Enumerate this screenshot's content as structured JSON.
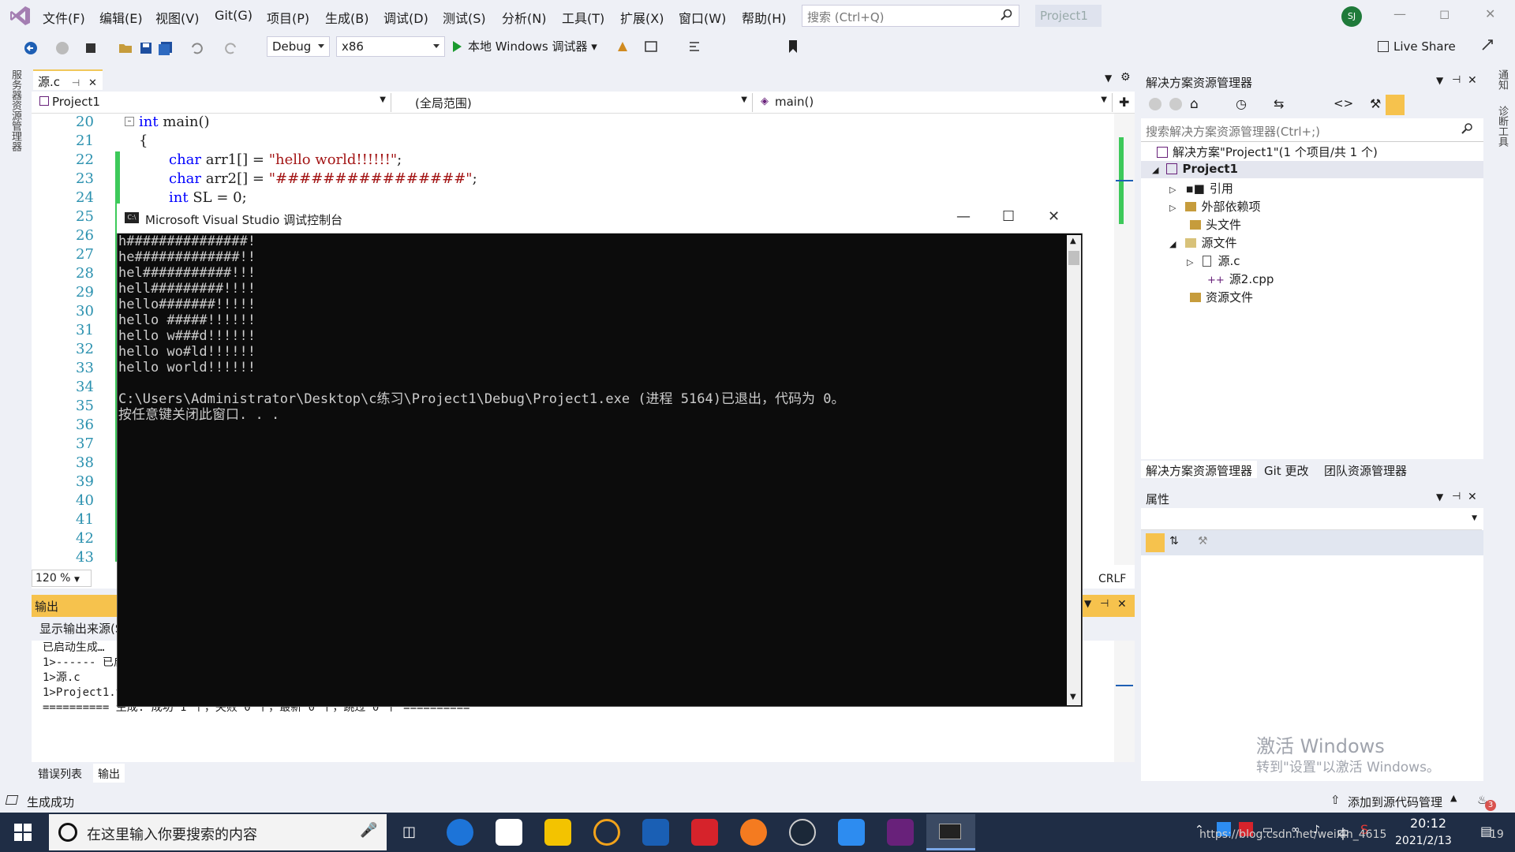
{
  "app": {
    "title": "Project1"
  },
  "menu": [
    "文件(F)",
    "编辑(E)",
    "视图(V)",
    "Git(G)",
    "项目(P)",
    "生成(B)",
    "调试(D)",
    "测试(S)",
    "分析(N)",
    "工具(T)",
    "扩展(X)",
    "窗口(W)",
    "帮助(H)"
  ],
  "search": {
    "placeholder": "搜索 (Ctrl+Q)"
  },
  "user": {
    "initials": "SJ"
  },
  "toolbar": {
    "config": "Debug",
    "platform": "x86",
    "run_label": "本地 Windows 调试器",
    "live_share": "Live Share"
  },
  "left_rail": {
    "label": "服务器资源管理器"
  },
  "right_rail": {
    "labels": [
      "通知",
      "诊断工具"
    ]
  },
  "editor": {
    "tab": "源.c",
    "nav": {
      "project": "Project1",
      "scope": "(全局范围)",
      "member": "main()"
    },
    "line_numbers": [
      "20",
      "21",
      "22",
      "23",
      "24",
      "25",
      "26",
      "27",
      "28",
      "29",
      "30",
      "31",
      "32",
      "33",
      "34",
      "35",
      "36",
      "37",
      "38",
      "39",
      "40",
      "41",
      "42",
      "43"
    ],
    "code": {
      "l20_kw": "int",
      "l20_rest": " main()",
      "l21": "{",
      "l22_kw": "char",
      "l22_mid": " arr1[] = ",
      "l22_str": "\"hello world!!!!!!\"",
      "l22_end": ";",
      "l23_kw": "char",
      "l23_mid": " arr2[] = ",
      "l23_str": "\"################\"",
      "l23_end": ";",
      "l24_kw": "int",
      "l24_rest": " SL = 0;"
    },
    "zoom": "120 %",
    "line_ending": "CRLF"
  },
  "console": {
    "title": "Microsoft Visual Studio 调试控制台",
    "lines": [
      "h###############!",
      "he#############!!",
      "hel###########!!!",
      "hell#########!!!!",
      "hello#######!!!!!",
      "hello #####!!!!!!",
      "hello w###d!!!!!!",
      "hello wo#ld!!!!!!",
      "hello world!!!!!!",
      "",
      "C:\\Users\\Administrator\\Desktop\\c练习\\Project1\\Debug\\Project1.exe (进程 5164)已退出，代码为 0。",
      "按任意键关闭此窗口. . ."
    ]
  },
  "output": {
    "title": "输出",
    "source_label": "显示输出来源(S",
    "lines": [
      "已启动生成…",
      "1>------ 已启",
      "1>源.c",
      "1>Project1.v",
      "========== 生成: 成功 1 个，失败 0 个，最新 0 个，跳过 0 个 =========="
    ],
    "tabs": [
      "错误列表",
      "输出"
    ]
  },
  "solution_explorer": {
    "title": "解决方案资源管理器",
    "search_placeholder": "搜索解决方案资源管理器(Ctrl+;)",
    "items": [
      {
        "label": "解决方案\"Project1\"(1 个项目/共 1 个)"
      },
      {
        "label": "Project1"
      },
      {
        "label": "引用"
      },
      {
        "label": "外部依赖项"
      },
      {
        "label": "头文件"
      },
      {
        "label": "源文件"
      },
      {
        "label": "源.c"
      },
      {
        "label": "源2.cpp"
      },
      {
        "label": "资源文件"
      }
    ],
    "tabs": [
      "解决方案资源管理器",
      "Git 更改",
      "团队资源管理器"
    ]
  },
  "properties": {
    "title": "属性"
  },
  "watermark": {
    "line1": "激活 Windows",
    "line2": "转到\"设置\"以激活 Windows。"
  },
  "status": {
    "left": "生成成功",
    "right": "添加到源代码管理",
    "notif_count": "3"
  },
  "taskbar": {
    "search_placeholder": "在这里输入你要搜索的内容",
    "tray_input": "中",
    "time": "20:12",
    "date": "2021/2/13",
    "url_overlay": "https://blog.csdn.net/weixin_4615",
    "url_suffix": "19"
  },
  "colors": {
    "accent": "#68217a",
    "status_bg": "#eef0f6",
    "taskbar": "#1f2d45",
    "output_header": "#f6c24d"
  }
}
